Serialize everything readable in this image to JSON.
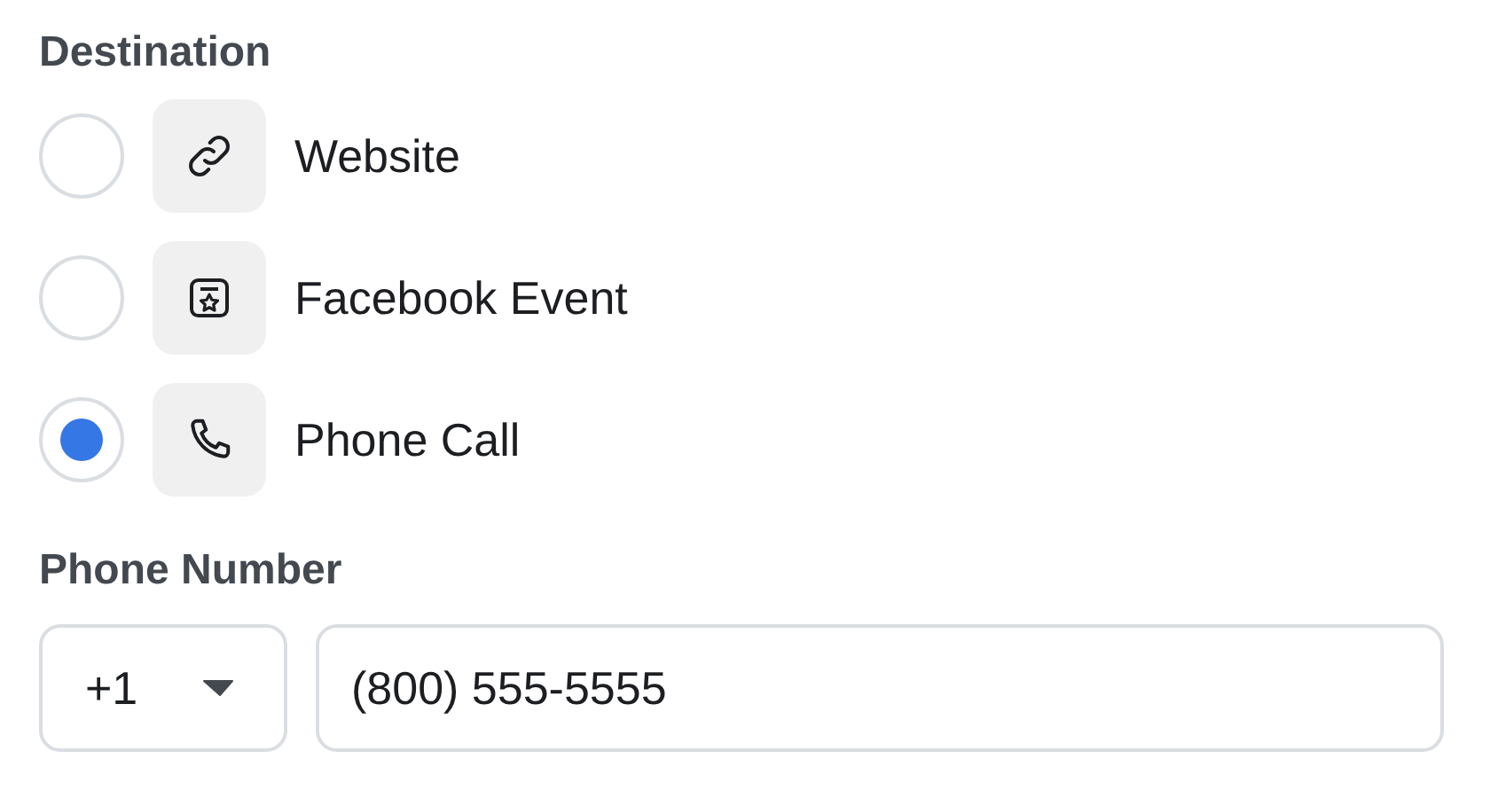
{
  "destination": {
    "title": "Destination",
    "options": [
      {
        "label": "Website",
        "kind": "link",
        "selected": false
      },
      {
        "label": "Facebook Event",
        "kind": "event",
        "selected": false
      },
      {
        "label": "Phone Call",
        "kind": "phone",
        "selected": true
      }
    ]
  },
  "phone_number": {
    "title": "Phone Number",
    "country_code": "+1",
    "value": "(800) 555-5555"
  }
}
